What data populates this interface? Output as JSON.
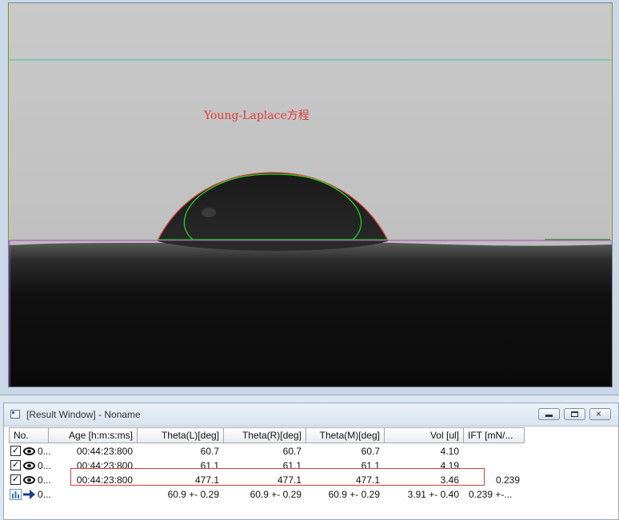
{
  "viewer": {
    "overlay_label": "Young-Laplace方程"
  },
  "result_window": {
    "title": "[Result Window] - Noname",
    "window_buttons": {
      "minimize": "minimize",
      "restore": "restore",
      "close": "×"
    },
    "columns": [
      "No.",
      "Age [h:m:s:ms]",
      "Theta(L)[deg]",
      "Theta(R)[deg]",
      "Theta(M)[deg]",
      "Vol [ul]",
      "IFT [mN/..."
    ],
    "rows": [
      {
        "no": "0...",
        "age": "00:44:23:800",
        "theta_l": "60.7",
        "theta_r": "60.7",
        "theta_m": "60.7",
        "vol": "4.10",
        "ift": ""
      },
      {
        "no": "0...",
        "age": "00:44:23:800",
        "theta_l": "61.1",
        "theta_r": "61.1",
        "theta_m": "61.1",
        "vol": "4.19",
        "ift": ""
      },
      {
        "no": "0...",
        "age": "00:44:23:800",
        "theta_l": "477.1",
        "theta_r": "477.1",
        "theta_m": "477.1",
        "vol": "3.46",
        "ift": "0.239"
      }
    ],
    "summary": {
      "no": "0...",
      "age": "",
      "theta_l": "60.9 +- 0.29",
      "theta_r": "60.9 +- 0.29",
      "theta_m": "60.9 +- 0.29",
      "vol": "3.91 +- 0.40",
      "ift": "0.239 +-..."
    },
    "checkbox_mark": "✓",
    "icons": {
      "row_check": "checkbox-checked-icon",
      "row_visible": "eye-icon",
      "summary_chart": "bar-chart-icon",
      "summary_arrow": "arrow-right-icon"
    }
  },
  "colors": {
    "fit_curve": "#22dd22",
    "profile_edge": "#e23a3a",
    "baseline": "#b040c0",
    "top_line": "#33c8a0",
    "highlight": "#d23c3c"
  }
}
